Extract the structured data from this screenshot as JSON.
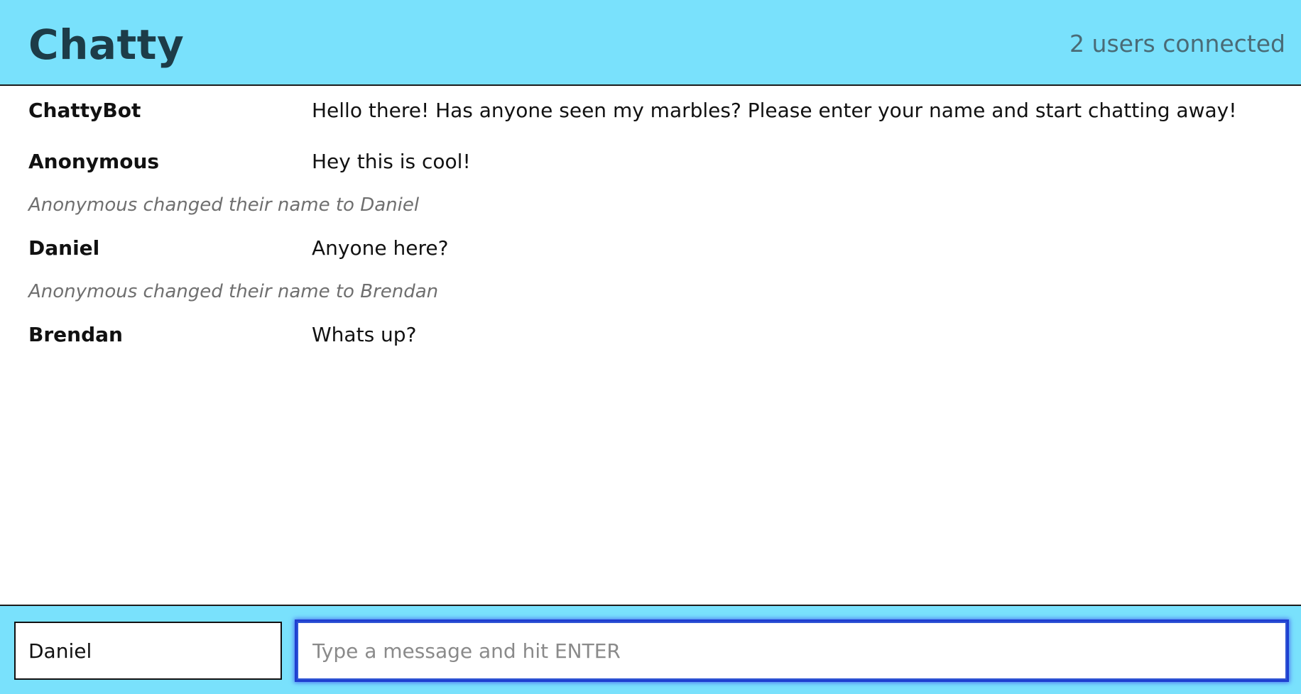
{
  "header": {
    "title": "Chatty",
    "users_connected": "2 users connected"
  },
  "messages": [
    {
      "type": "message",
      "username": "ChattyBot",
      "content": "Hello there! Has anyone seen my marbles? Please enter your name and start chatting away!"
    },
    {
      "type": "message",
      "username": "Anonymous",
      "content": "Hey this is cool!"
    },
    {
      "type": "notification",
      "content": "Anonymous changed their name to Daniel"
    },
    {
      "type": "message",
      "username": "Daniel",
      "content": "Anyone here?"
    },
    {
      "type": "notification",
      "content": "Anonymous changed their name to Brendan"
    },
    {
      "type": "message",
      "username": "Brendan",
      "content": "Whats up?"
    }
  ],
  "composer": {
    "username_value": "Daniel",
    "message_value": "",
    "message_placeholder": "Type a message and hit ENTER"
  },
  "colors": {
    "bar_background": "#79e1fc",
    "title_color": "#1d3c48",
    "focus_ring": "#1f3fd0"
  }
}
